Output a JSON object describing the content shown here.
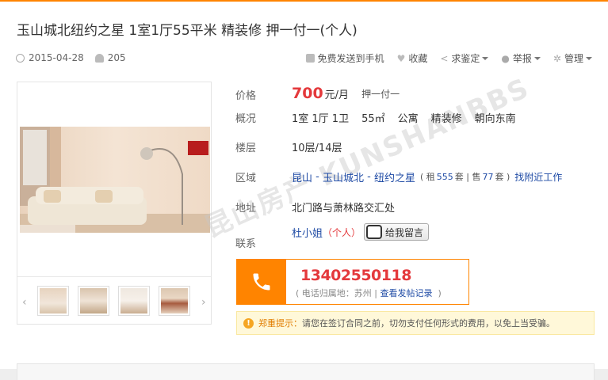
{
  "header": {
    "title": "玉山城北纽约之星 1室1厅55平米 精装修 押一付一(个人)",
    "date": "2015-04-28",
    "views": "205"
  },
  "actions": {
    "send_phone": "免费发送到手机",
    "favorite": "收藏",
    "appraise": "求鉴定",
    "report": "举报",
    "manage": "管理"
  },
  "info": {
    "price_label": "价格",
    "price": "700",
    "price_unit": "元/月",
    "pay_method": "押一付一",
    "overview_label": "概况",
    "overview_items": [
      "1室 1厅 1卫",
      "55㎡",
      "公寓",
      "精装修",
      "朝向东南"
    ],
    "floor_label": "楼层",
    "floor": "10层/14层",
    "area_label": "区域",
    "area_city": "昆山",
    "area_sep1": " - ",
    "area_district": "玉山城北",
    "area_sep2": " - ",
    "area_estate": "纽约之星",
    "rent_prefix": "( 租",
    "rent_count": "555",
    "rent_suffix": "套 | 售",
    "sale_count": "77",
    "sale_suffix": "套 )",
    "nearby_jobs": "找附近工作",
    "address_label": "地址",
    "address": "北门路与萧林路交汇处",
    "contact_label": "联系",
    "contact_name": "杜小姐",
    "contact_type": "（个人）",
    "message_button": "给我留言"
  },
  "phone": {
    "number": "13402550118",
    "location_prefix": "( 电话归属地：苏州",
    "view_posts": "查看发帖记录",
    "location_suffix": " )"
  },
  "warning": {
    "title": "郑重提示：",
    "text": "请您在签订合同之前，切勿支付任何形式的费用，以免上当受骗。"
  },
  "gallery": {
    "prev": "‹",
    "next": "›"
  },
  "watermark": "昆山房产 KUNSHANBBS",
  "colors": {
    "accent": "#ff8400",
    "price": "#e4393c",
    "link": "#1f4ba5"
  }
}
